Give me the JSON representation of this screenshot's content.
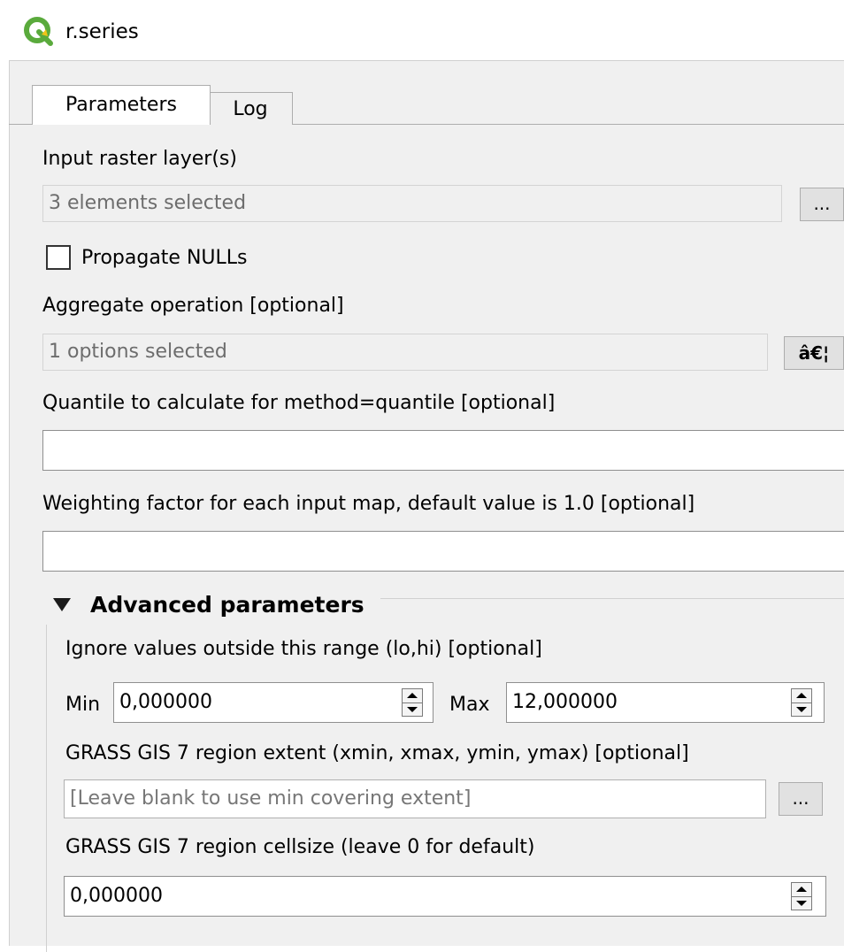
{
  "window": {
    "title": "r.series",
    "icon": "qgis-logo-icon"
  },
  "tabs": [
    {
      "label": "Parameters",
      "active": true
    },
    {
      "label": "Log",
      "active": false
    }
  ],
  "params": {
    "input_raster": {
      "label": "Input raster layer(s)",
      "value": "3 elements selected",
      "button": "..."
    },
    "propagate_nulls": {
      "label": "Propagate NULLs",
      "checked": false
    },
    "aggregate": {
      "label": "Aggregate operation [optional]",
      "value": "1 options selected",
      "button": "â€¦"
    },
    "quantile": {
      "label": "Quantile to calculate for method=quantile [optional]",
      "value": ""
    },
    "weighting": {
      "label": "Weighting factor for each input map, default value is 1.0 [optional]",
      "value": ""
    }
  },
  "advanced": {
    "title": "Advanced parameters",
    "expanded": true,
    "range": {
      "label": "Ignore values outside this range (lo,hi) [optional]",
      "min_label": "Min",
      "min_value": "0,000000",
      "max_label": "Max",
      "max_value": "12,000000"
    },
    "region_extent": {
      "label": "GRASS GIS 7 region extent (xmin, xmax, ymin, ymax) [optional]",
      "placeholder": "[Leave blank to use min covering extent]",
      "button": "..."
    },
    "cellsize": {
      "label": "GRASS GIS 7 region cellsize (leave 0 for default)",
      "value": "0,000000"
    }
  },
  "colors": {
    "panel_bg": "#f0f0f0",
    "qgis_green": "#5aaa3c",
    "qgis_yellow": "#f0c418"
  }
}
